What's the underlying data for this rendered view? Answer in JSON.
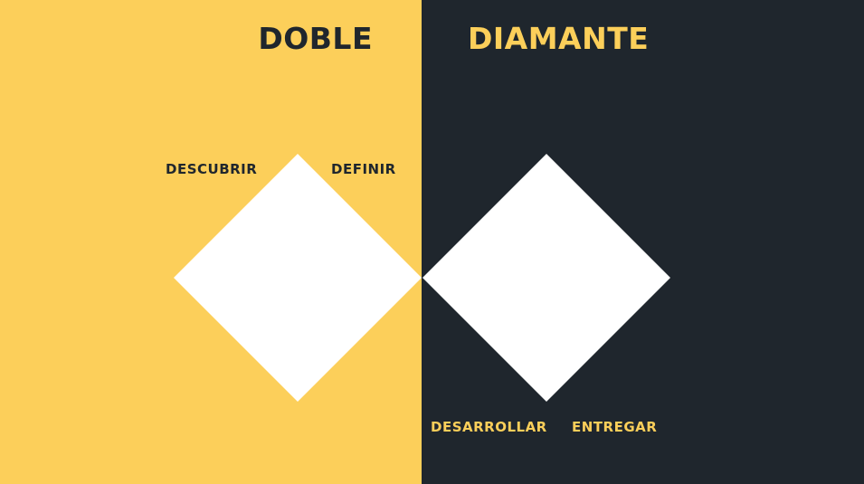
{
  "title": {
    "left_word": "DOBLE",
    "right_word": "DIAMANTE"
  },
  "phases": {
    "discover": "DESCUBRIR",
    "define": "DEFINIR",
    "develop": "DESARROLLAR",
    "deliver": "ENTREGAR"
  },
  "colors": {
    "yellow": "#FCCF5A",
    "dark": "#1F262D",
    "white": "#FFFFFF"
  }
}
